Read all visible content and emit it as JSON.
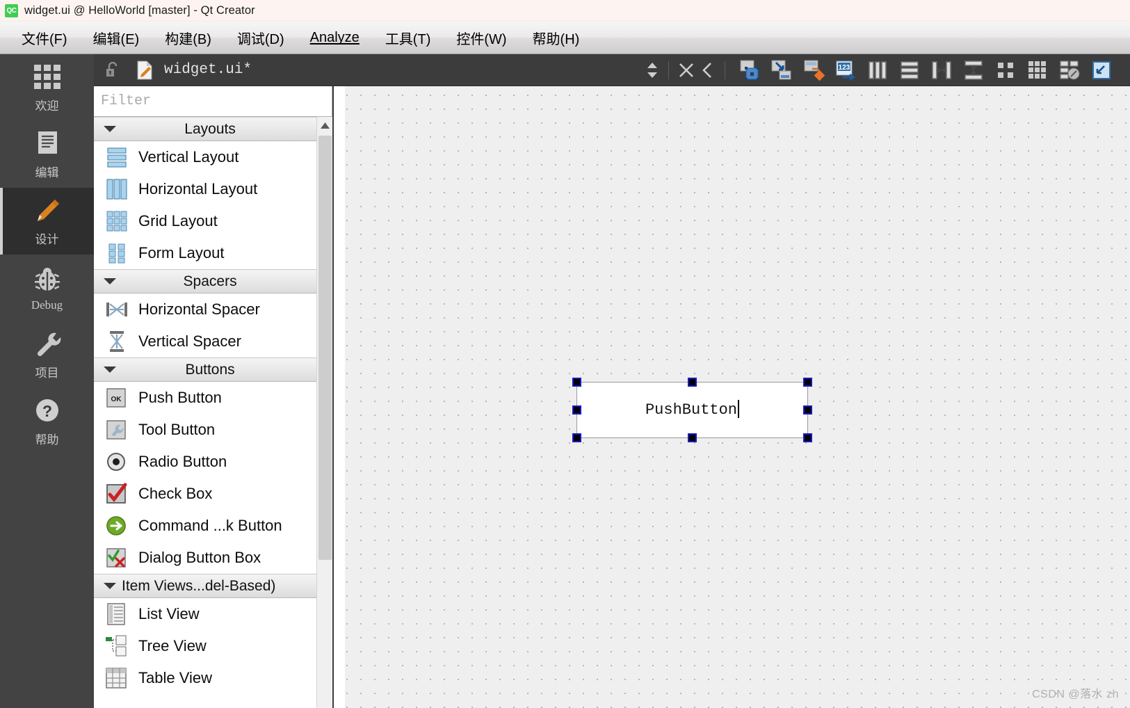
{
  "window": {
    "title": "widget.ui @ HelloWorld [master] - Qt Creator",
    "logo_text": "QC"
  },
  "menubar": {
    "items": [
      {
        "label": "文件(F)",
        "mnemonic": "F"
      },
      {
        "label": "编辑(E)",
        "mnemonic": "E"
      },
      {
        "label": "构建(B)",
        "mnemonic": "B"
      },
      {
        "label": "调试(D)",
        "mnemonic": "D"
      },
      {
        "label": "Analyze",
        "mnemonic": "A"
      },
      {
        "label": "工具(T)",
        "mnemonic": "T"
      },
      {
        "label": "控件(W)",
        "mnemonic": "W"
      },
      {
        "label": "帮助(H)",
        "mnemonic": "H"
      }
    ]
  },
  "modebar": {
    "items": [
      {
        "label": "欢迎",
        "icon": "grid-icon",
        "active": false
      },
      {
        "label": "编辑",
        "icon": "document-lines-icon",
        "active": false
      },
      {
        "label": "设计",
        "icon": "pencil-icon",
        "active": true
      },
      {
        "label": "Debug",
        "icon": "bug-icon",
        "active": false
      },
      {
        "label": "项目",
        "icon": "wrench-icon",
        "active": false
      },
      {
        "label": "帮助",
        "icon": "question-mark-icon",
        "active": false
      }
    ]
  },
  "editor_toolbar": {
    "lock_icon": "unlocked-padlock-icon",
    "file_icon": "ui-file-icon",
    "file_name": "widget.ui*",
    "nav_icon": "up-down-arrows-icon",
    "close_icon": "close-x-icon",
    "back_icon": "chevron-left-icon",
    "tools": [
      {
        "name": "edit-widgets-icon",
        "title": "Edit Widgets"
      },
      {
        "name": "edit-signals-slots-icon",
        "title": "Edit Signals/Slots"
      },
      {
        "name": "edit-buddies-icon",
        "title": "Edit Buddies"
      },
      {
        "name": "edit-tab-order-icon",
        "title": "Edit Tab Order"
      },
      {
        "name": "layout-horizontally-icon",
        "title": "Lay Out Horizontally"
      },
      {
        "name": "layout-vertically-icon",
        "title": "Lay Out Vertically"
      },
      {
        "name": "layout-splitter-horizontal-icon",
        "title": "Lay Out Horizontally in Splitter"
      },
      {
        "name": "layout-splitter-vertical-icon",
        "title": "Lay Out Vertically in Splitter"
      },
      {
        "name": "layout-form-icon",
        "title": "Lay Out in a Form Layout"
      },
      {
        "name": "layout-grid-icon",
        "title": "Lay Out in a Grid"
      },
      {
        "name": "break-layout-icon",
        "title": "Break Layout"
      },
      {
        "name": "adjust-size-icon",
        "title": "Adjust Size"
      }
    ]
  },
  "widgetbox": {
    "filter_placeholder": "Filter",
    "filter_value": "",
    "sections": [
      {
        "header": "Layouts",
        "expanded": true,
        "items": [
          {
            "label": "Vertical Layout",
            "icon": "vertical-layout-icon"
          },
          {
            "label": "Horizontal Layout",
            "icon": "horizontal-layout-icon"
          },
          {
            "label": "Grid Layout",
            "icon": "grid-layout-icon"
          },
          {
            "label": "Form Layout",
            "icon": "form-layout-icon"
          }
        ]
      },
      {
        "header": "Spacers",
        "expanded": true,
        "items": [
          {
            "label": "Horizontal Spacer",
            "icon": "horizontal-spacer-icon"
          },
          {
            "label": "Vertical Spacer",
            "icon": "vertical-spacer-icon"
          }
        ]
      },
      {
        "header": "Buttons",
        "expanded": true,
        "items": [
          {
            "label": "Push Button",
            "icon": "push-button-icon"
          },
          {
            "label": "Tool Button",
            "icon": "tool-button-icon"
          },
          {
            "label": "Radio Button",
            "icon": "radio-button-icon"
          },
          {
            "label": "Check Box",
            "icon": "check-box-icon"
          },
          {
            "label": "Command ...k Button",
            "icon": "command-link-button-icon"
          },
          {
            "label": "Dialog Button Box",
            "icon": "dialog-button-box-icon"
          }
        ]
      },
      {
        "header": "Item Views...del-Based)",
        "expanded": true,
        "items": [
          {
            "label": "List View",
            "icon": "list-view-icon"
          },
          {
            "label": "Tree View",
            "icon": "tree-view-icon"
          },
          {
            "label": "Table View",
            "icon": "table-view-icon"
          }
        ]
      }
    ]
  },
  "canvas": {
    "selected_widget": {
      "type": "push-button",
      "text": "PushButton",
      "editing": true
    },
    "watermark": "CSDN @落水 zh"
  }
}
